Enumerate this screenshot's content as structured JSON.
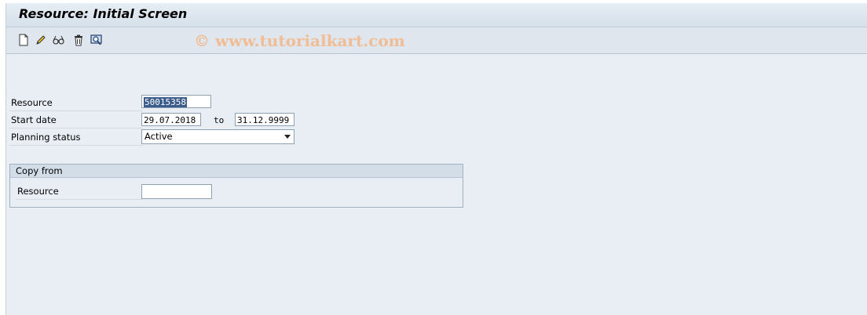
{
  "window": {
    "title": "Resource: Initial Screen"
  },
  "toolbar": {
    "icons": [
      "new-icon",
      "edit-icon",
      "display-icon",
      "delete-icon",
      "overview-icon"
    ],
    "watermark": "© www.tutorialkart.com"
  },
  "form": {
    "resource_label": "Resource",
    "resource_value": "50015358",
    "start_date_label": "Start date",
    "start_date_value": "29.07.2018",
    "to_label": "to",
    "end_date_value": "31.12.9999",
    "planning_status_label": "Planning status",
    "planning_status_value": "Active"
  },
  "copy_from": {
    "heading": "Copy from",
    "resource_label": "Resource",
    "resource_value": ""
  },
  "colors": {
    "background": "#e9eef5",
    "selection": "#3b5c8c",
    "watermark": "#f0bd95"
  }
}
